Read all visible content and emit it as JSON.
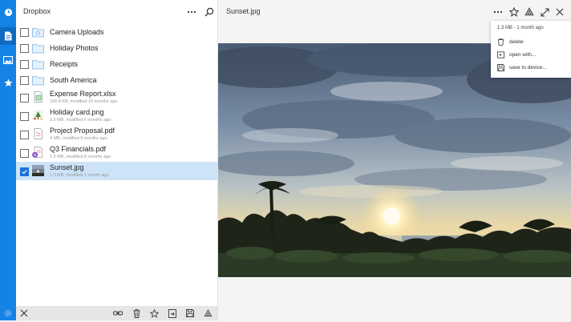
{
  "app": {
    "title": "Dropbox"
  },
  "rail": {
    "items": [
      {
        "icon": "clock-icon"
      },
      {
        "icon": "document-icon",
        "active": true
      },
      {
        "icon": "photos-icon"
      },
      {
        "icon": "star-icon"
      }
    ],
    "bottom_icon": "settings-icon"
  },
  "files": [
    {
      "name": "Camera Uploads",
      "type": "folder-camera"
    },
    {
      "name": "Holiday Photos",
      "type": "folder"
    },
    {
      "name": "Receipts",
      "type": "folder"
    },
    {
      "name": "South America",
      "type": "folder"
    },
    {
      "name": "Expense Report.xlsx",
      "meta": "156.8 KB, modified 10 months ago",
      "type": "spreadsheet"
    },
    {
      "name": "Holiday card.png",
      "meta": "3.5 MB, modified 6 months ago",
      "type": "image"
    },
    {
      "name": "Project Proposal.pdf",
      "meta": "4 MB, modified 6 months ago",
      "type": "pdf"
    },
    {
      "name": "Q3 Financials.pdf",
      "meta": "1.5 MB, modified 8 months ago",
      "type": "pdf-badge"
    },
    {
      "name": "Sunset.jpg",
      "meta": "1.3 MB, modified 1 month ago",
      "type": "photo",
      "selected": true
    }
  ],
  "viewer": {
    "title": "Sunset.jpg",
    "info": "1.3 MB - 1 month ago",
    "menu": [
      {
        "label": "delete",
        "icon": "trash-icon"
      },
      {
        "label": "open with...",
        "icon": "open-with-icon"
      },
      {
        "label": "save to device...",
        "icon": "save-icon"
      }
    ]
  },
  "colors": {
    "accent": "#1583e6",
    "selected_row": "#cde3f7",
    "checkbox": "#1a73d9"
  }
}
